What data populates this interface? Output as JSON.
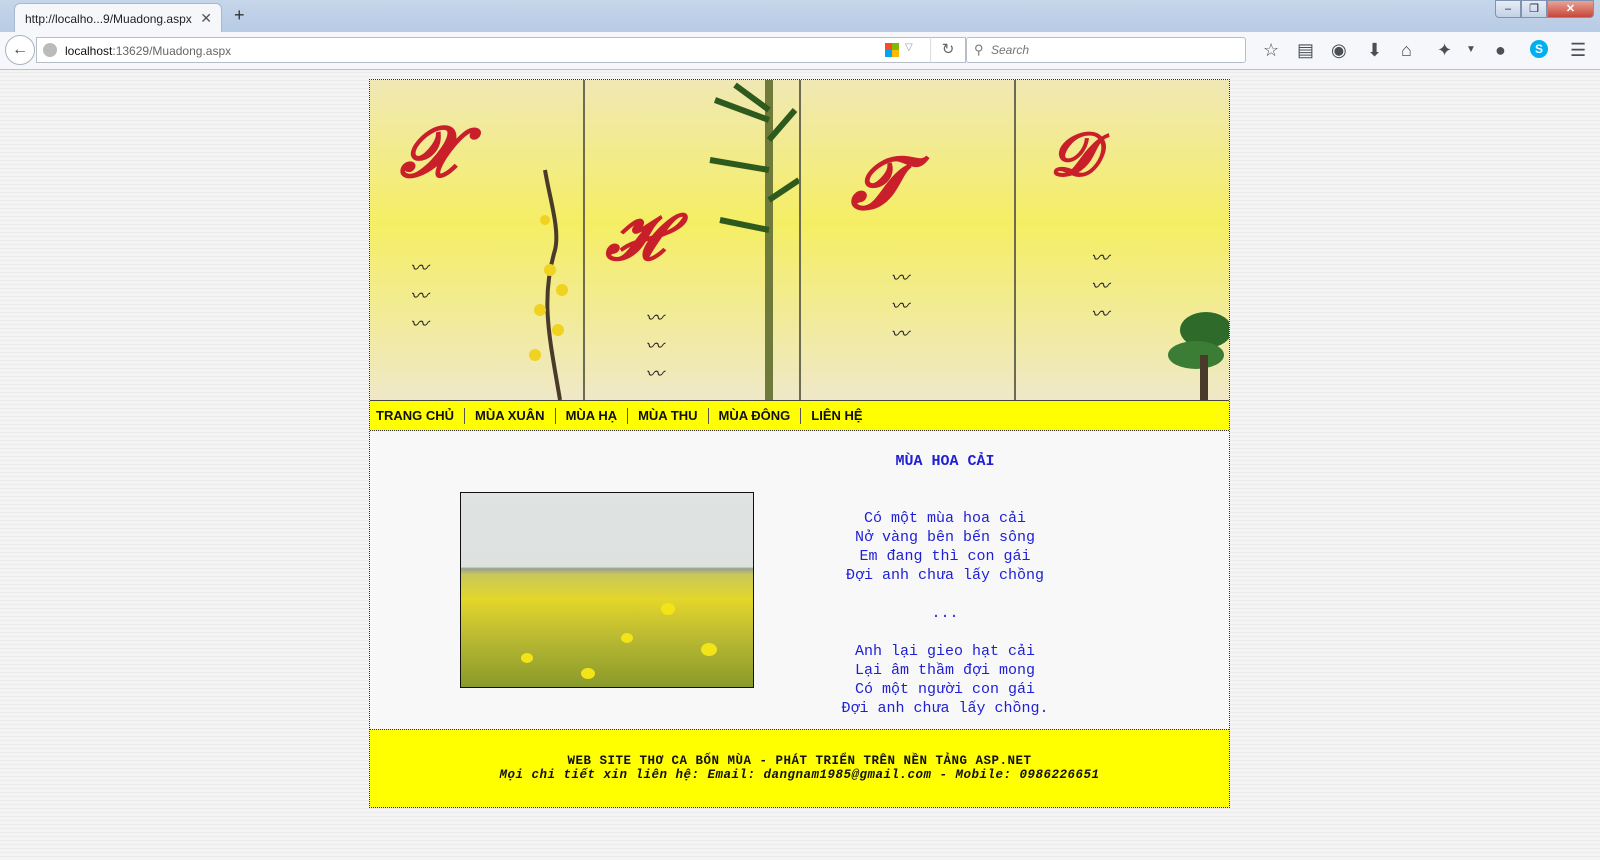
{
  "browser": {
    "tab_title": "http://localho...9/Muadong.aspx",
    "tab_close": "✕",
    "new_tab": "+",
    "url_host": "localhost",
    "url_path": ":13629/Muadong.aspx",
    "search_placeholder": "Search",
    "window_buttons": {
      "minimize": "–",
      "maximize": "❐",
      "close": "✕"
    }
  },
  "menu": {
    "items": [
      "TRANG CHỦ",
      "MÙA XUÂN",
      "MÙA HẠ",
      "MÙA THU",
      "MÙA ĐÔNG",
      "LIÊN HỆ"
    ]
  },
  "poem": {
    "title": "MÙA HOA CẢI",
    "stanza1": [
      "Có một mùa hoa cải",
      "Nở vàng bên bến sông",
      "Em đang thì con gái",
      "Đợi anh chưa lấy chồng"
    ],
    "ellipsis": "...",
    "stanza2": [
      "Anh lại gieo hạt cải",
      "Lại âm thầm đợi mong",
      "Có một người con gái",
      "Đợi anh chưa lấy chồng."
    ]
  },
  "footer": {
    "line1": "WEB SITE THƠ CA BỐN MÙA - PHÁT TRIỂN TRÊN NỀN TẢNG ASP.NET",
    "line2": "Mọi chi tiết xin liên hệ: Email: dangnam1985@gmail.com - Mobile: 0986226651"
  },
  "colors": {
    "menu_bg": "#ffff00",
    "poem_text": "#1f1fd6",
    "calligraphy": "#c81f2b"
  }
}
